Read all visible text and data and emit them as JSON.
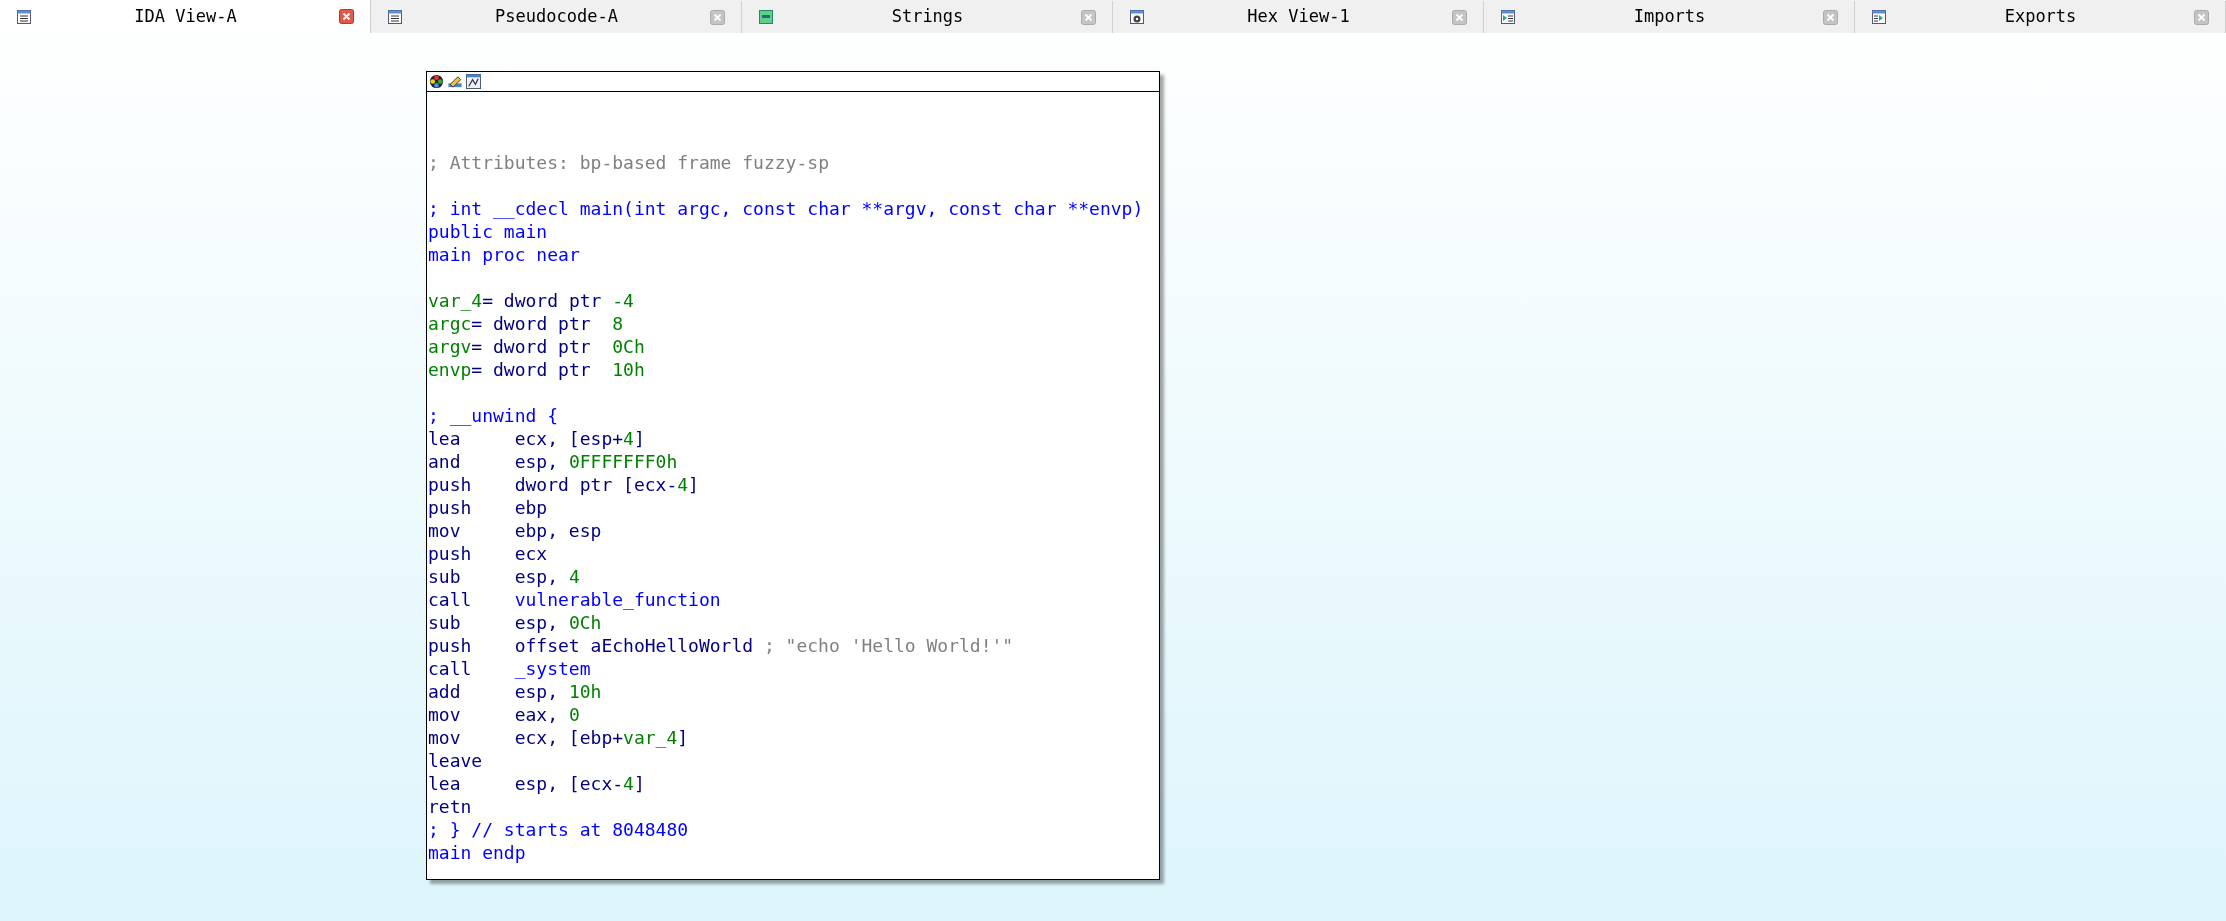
{
  "tabs": [
    {
      "label": "IDA View-A",
      "selected": true,
      "kind": "disassembly"
    },
    {
      "label": "Pseudocode-A",
      "selected": false,
      "kind": "pseudocode"
    },
    {
      "label": "Strings",
      "selected": false,
      "kind": "strings"
    },
    {
      "label": "Hex View-1",
      "selected": false,
      "kind": "hex"
    },
    {
      "label": "Imports",
      "selected": false,
      "kind": "imports"
    },
    {
      "label": "Exports",
      "selected": false,
      "kind": "exports"
    }
  ],
  "graph_node": {
    "lines": [
      {
        "kind": "blank"
      },
      {
        "kind": "text",
        "segments": [
          {
            "kind": "comment",
            "text": "; Attributes: bp-based frame fuzzy-sp"
          }
        ]
      },
      {
        "kind": "blank"
      },
      {
        "kind": "text",
        "segments": [
          {
            "kind": "directive",
            "text": "; int __cdecl main(int argc, const char **argv, const char **envp)"
          }
        ]
      },
      {
        "kind": "text",
        "segments": [
          {
            "kind": "directive",
            "text": "public main"
          }
        ]
      },
      {
        "kind": "text",
        "segments": [
          {
            "kind": "directive",
            "text": "main proc near"
          }
        ]
      },
      {
        "kind": "blank"
      },
      {
        "kind": "text",
        "segments": [
          {
            "kind": "name",
            "text": "var_4"
          },
          {
            "kind": "plain",
            "text": "= dword ptr "
          },
          {
            "kind": "number",
            "text": "-4"
          }
        ]
      },
      {
        "kind": "text",
        "segments": [
          {
            "kind": "name",
            "text": "argc"
          },
          {
            "kind": "plain",
            "text": "= dword ptr  "
          },
          {
            "kind": "number",
            "text": "8"
          }
        ]
      },
      {
        "kind": "text",
        "segments": [
          {
            "kind": "name",
            "text": "argv"
          },
          {
            "kind": "plain",
            "text": "= dword ptr  "
          },
          {
            "kind": "number",
            "text": "0Ch"
          }
        ]
      },
      {
        "kind": "text",
        "segments": [
          {
            "kind": "name",
            "text": "envp"
          },
          {
            "kind": "plain",
            "text": "= dword ptr  "
          },
          {
            "kind": "number",
            "text": "10h"
          }
        ]
      },
      {
        "kind": "blank"
      },
      {
        "kind": "text",
        "segments": [
          {
            "kind": "directive",
            "text": "; __unwind {"
          }
        ]
      },
      {
        "kind": "insn",
        "mnemonic": "lea",
        "segments": [
          {
            "kind": "plain",
            "text": "ecx, [esp+"
          },
          {
            "kind": "number",
            "text": "4"
          },
          {
            "kind": "plain",
            "text": "]"
          }
        ]
      },
      {
        "kind": "insn",
        "mnemonic": "and",
        "segments": [
          {
            "kind": "plain",
            "text": "esp, "
          },
          {
            "kind": "number",
            "text": "0FFFFFFF0h"
          }
        ]
      },
      {
        "kind": "insn",
        "mnemonic": "push",
        "segments": [
          {
            "kind": "plain",
            "text": "dword ptr [ecx-"
          },
          {
            "kind": "number",
            "text": "4"
          },
          {
            "kind": "plain",
            "text": "]"
          }
        ]
      },
      {
        "kind": "insn",
        "mnemonic": "push",
        "segments": [
          {
            "kind": "plain",
            "text": "ebp"
          }
        ]
      },
      {
        "kind": "insn",
        "mnemonic": "mov",
        "segments": [
          {
            "kind": "plain",
            "text": "ebp, esp"
          }
        ]
      },
      {
        "kind": "insn",
        "mnemonic": "push",
        "segments": [
          {
            "kind": "plain",
            "text": "ecx"
          }
        ]
      },
      {
        "kind": "insn",
        "mnemonic": "sub",
        "segments": [
          {
            "kind": "plain",
            "text": "esp, "
          },
          {
            "kind": "number",
            "text": "4"
          }
        ]
      },
      {
        "kind": "insn",
        "mnemonic": "call",
        "segments": [
          {
            "kind": "directive",
            "text": "vulnerable_function"
          }
        ]
      },
      {
        "kind": "insn",
        "mnemonic": "sub",
        "segments": [
          {
            "kind": "plain",
            "text": "esp, "
          },
          {
            "kind": "number",
            "text": "0Ch"
          }
        ]
      },
      {
        "kind": "insn",
        "mnemonic": "push",
        "segments": [
          {
            "kind": "plain",
            "text": "offset aEchoHelloWorld "
          },
          {
            "kind": "comment",
            "text": "; \"echo 'Hello World!'\""
          }
        ]
      },
      {
        "kind": "insn",
        "mnemonic": "call",
        "segments": [
          {
            "kind": "directive",
            "text": "_system"
          }
        ]
      },
      {
        "kind": "insn",
        "mnemonic": "add",
        "segments": [
          {
            "kind": "plain",
            "text": "esp, "
          },
          {
            "kind": "number",
            "text": "10h"
          }
        ]
      },
      {
        "kind": "insn",
        "mnemonic": "mov",
        "segments": [
          {
            "kind": "plain",
            "text": "eax, "
          },
          {
            "kind": "number",
            "text": "0"
          }
        ]
      },
      {
        "kind": "insn",
        "mnemonic": "mov",
        "segments": [
          {
            "kind": "plain",
            "text": "ecx, [ebp+"
          },
          {
            "kind": "number",
            "text": "var_4"
          },
          {
            "kind": "plain",
            "text": "]"
          }
        ]
      },
      {
        "kind": "insn",
        "mnemonic": "leave"
      },
      {
        "kind": "insn",
        "mnemonic": "lea",
        "segments": [
          {
            "kind": "plain",
            "text": "esp, [ecx-"
          },
          {
            "kind": "number",
            "text": "4"
          },
          {
            "kind": "plain",
            "text": "]"
          }
        ]
      },
      {
        "kind": "insn",
        "mnemonic": "retn"
      },
      {
        "kind": "text",
        "segments": [
          {
            "kind": "directive",
            "text": "; } // starts at 8048480"
          }
        ]
      },
      {
        "kind": "text",
        "segments": [
          {
            "kind": "directive",
            "text": "main endp"
          }
        ]
      }
    ]
  }
}
